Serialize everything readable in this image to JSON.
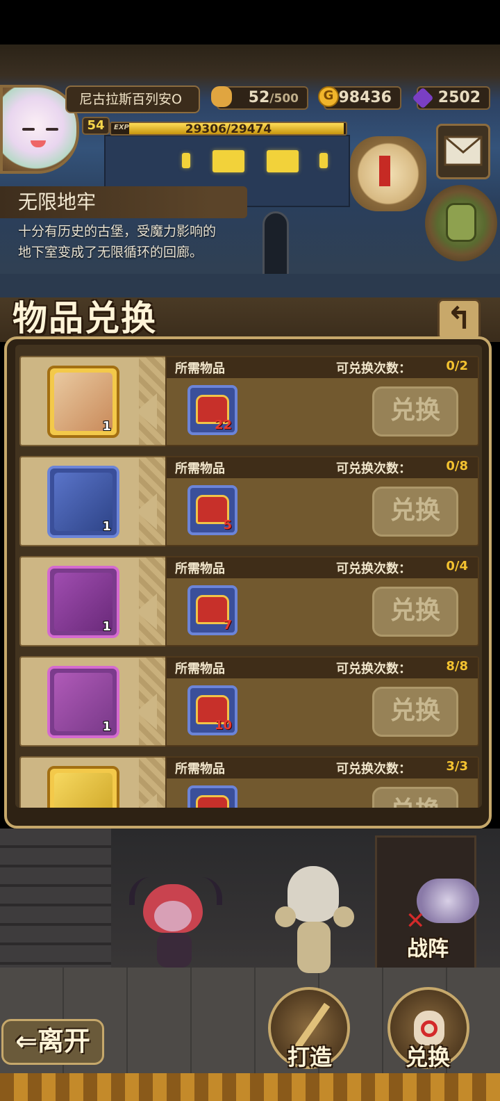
{
  "player": {
    "name": "尼古拉斯百列安O",
    "level": "54",
    "exp_label": "EXP",
    "exp_text": "29306/29474",
    "exp_fraction": 0.994
  },
  "resources": {
    "stamina_current": "52",
    "stamina_max": "/500",
    "gold": "98436",
    "gems": "2502"
  },
  "dungeon": {
    "title": "无限地牢",
    "description_line1": "十分有历史的古堡，受魔力影响的",
    "description_line2": "地下室变成了无限循环的回廊。"
  },
  "exchange": {
    "title": "物品兑换",
    "back_icon": "↰",
    "required_label": "所需物品",
    "count_label": "可兑换次数：",
    "button_label": "兑换",
    "rows": [
      {
        "reward_icon": "ticket-icon",
        "reward_qty": "1",
        "frame": "gold",
        "req_qty": "22",
        "count": "0/2"
      },
      {
        "reward_icon": "pickaxe-blue-icon",
        "reward_qty": "1",
        "frame": "blue",
        "req_qty": "5",
        "count": "0/8"
      },
      {
        "reward_icon": "pickaxe-purple-icon",
        "reward_qty": "1",
        "frame": "purple",
        "req_qty": "7",
        "count": "0/4"
      },
      {
        "reward_icon": "fuel-tank-icon",
        "reward_qty": "1",
        "frame": "purple",
        "req_qty": "10",
        "count": "8/8"
      },
      {
        "reward_icon": "mirror-icon",
        "reward_qty": "",
        "frame": "gold",
        "req_qty": "",
        "count": "3/3"
      }
    ]
  },
  "nav": {
    "formation": "战阵",
    "leave": "离开",
    "forge": "打造",
    "exchange": "兑换"
  },
  "colors": {
    "accent_gold": "#f3c230",
    "panel_border": "#c6a86b"
  }
}
